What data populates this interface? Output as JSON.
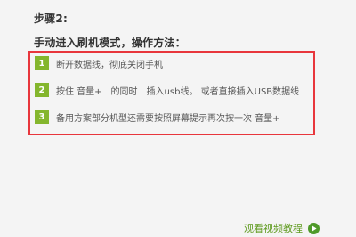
{
  "step_title": "步骤2:",
  "subtitle": "手动进入刷机模式，操作方法：",
  "steps": [
    {
      "num": "1",
      "text": "断开数据线，彻底关闭手机"
    },
    {
      "num": "2",
      "text": "按住 音量+　的同时　插入usb线。 或者直接插入USB数据线"
    },
    {
      "num": "3",
      "text": "备用方案部分机型还需要按照屏幕提示再次按一次 音量+"
    }
  ],
  "video_link": {
    "label": "观看视频教程",
    "icon": "play-icon"
  },
  "colors": {
    "accent_green": "#84b62d",
    "link_green": "#5e9a1e",
    "highlight_red": "#e8363c",
    "background": "#f4f4f4"
  }
}
